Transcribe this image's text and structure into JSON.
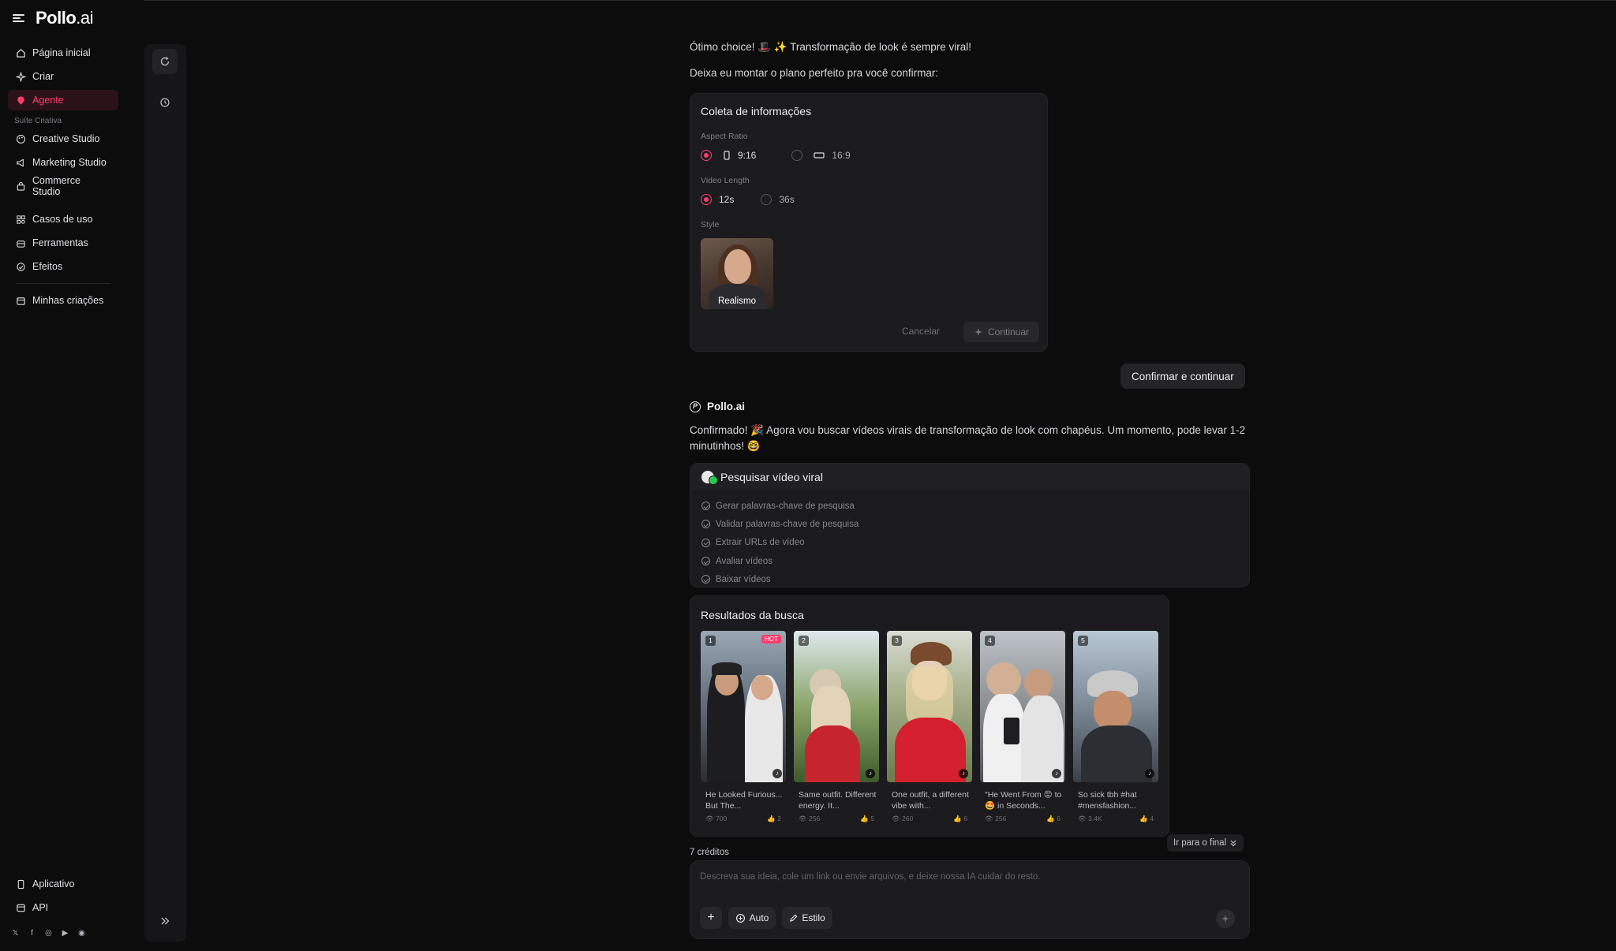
{
  "brand": {
    "logo_main": "Pollo",
    "logo_suffix": ".ai"
  },
  "sidebar": {
    "items": [
      {
        "label": "Página inicial",
        "icon": "home-icon"
      },
      {
        "label": "Criar",
        "icon": "sparkle-icon"
      },
      {
        "label": "Agente",
        "icon": "agent-icon",
        "active": true
      }
    ],
    "group_label": "Suíte Criativa",
    "studio_items": [
      {
        "label": "Creative Studio",
        "icon": "palette-icon"
      },
      {
        "label": "Marketing Studio",
        "icon": "megaphone-icon"
      },
      {
        "label": "Commerce Studio",
        "icon": "shopping-bag-icon"
      }
    ],
    "more_items": [
      {
        "label": "Casos de uso",
        "icon": "grid-icon"
      },
      {
        "label": "Ferramentas",
        "icon": "toolbox-icon"
      },
      {
        "label": "Efeitos",
        "icon": "effects-icon"
      }
    ],
    "my_item": {
      "label": "Minhas criações",
      "icon": "archive-icon"
    },
    "bottom_items": [
      {
        "label": "Aplicativo",
        "icon": "phone-icon"
      },
      {
        "label": "API",
        "icon": "api-icon"
      }
    ],
    "socials": [
      "x-icon",
      "facebook-icon",
      "instagram-icon",
      "youtube-icon",
      "discord-icon"
    ]
  },
  "chat": {
    "msg1": "Ótimo choice! 🎩 ✨ Transformação de look é sempre viral!",
    "msg2": "Deixa eu montar o plano perfeito pra você confirmar:",
    "collect": {
      "title": "Coleta de informações",
      "aspect_label": "Aspect Ratio",
      "aspect_opt1": "9:16",
      "aspect_opt2": "16:9",
      "length_label": "Video Length",
      "length_opt1": "12s",
      "length_opt2": "36s",
      "style_label": "Style",
      "style_name": "Realismo",
      "cancel": "Cancelar",
      "continue": "Continuar"
    },
    "user_reply": "Confirmar e continuar",
    "bot_name": "Pollo.ai",
    "bot_msg": "Confirmado! 🎉 Agora vou buscar vídeos virais de transformação de look com chapéus. Um momento, pode levar 1-2 minutinhos! 🤓",
    "search": {
      "title": "Pesquisar vídeo viral",
      "steps": [
        "Gerar palavras-chave de pesquisa",
        "Validar palavras-chave de pesquisa",
        "Extrair URLs de vídeo",
        "Avaliar vídeos",
        "Baixar vídeos"
      ]
    },
    "results": {
      "title": "Resultados da busca",
      "items": [
        {
          "num": "1",
          "hot": "HOT",
          "caption": "He Looked Furious... But The...",
          "views": "700",
          "likes": "2"
        },
        {
          "num": "2",
          "caption": "Same outfit. Different energy. It...",
          "views": "256",
          "likes": "5"
        },
        {
          "num": "3",
          "caption": "One outfit, a different vibe with...",
          "views": "260",
          "likes": "6"
        },
        {
          "num": "4",
          "caption": "\"He Went From 😡 to 🤩 in Seconds...",
          "views": "256",
          "likes": "6"
        },
        {
          "num": "5",
          "caption": "So sick tbh #hat #mensfashion...",
          "views": "3.4K",
          "likes": "4"
        }
      ]
    },
    "credits": "7 créditos",
    "goto_end": "Ir para o final"
  },
  "composer": {
    "placeholder": "Descreva sua ideia, cole um link ou envie arquivos, e deixe nossa IA cuidar do resto.",
    "auto": "Auto",
    "estilo": "Estilo"
  },
  "colors": {
    "accent": "#ff3d6a",
    "bg": "#0c0c0d",
    "card": "#1b1b1e"
  }
}
